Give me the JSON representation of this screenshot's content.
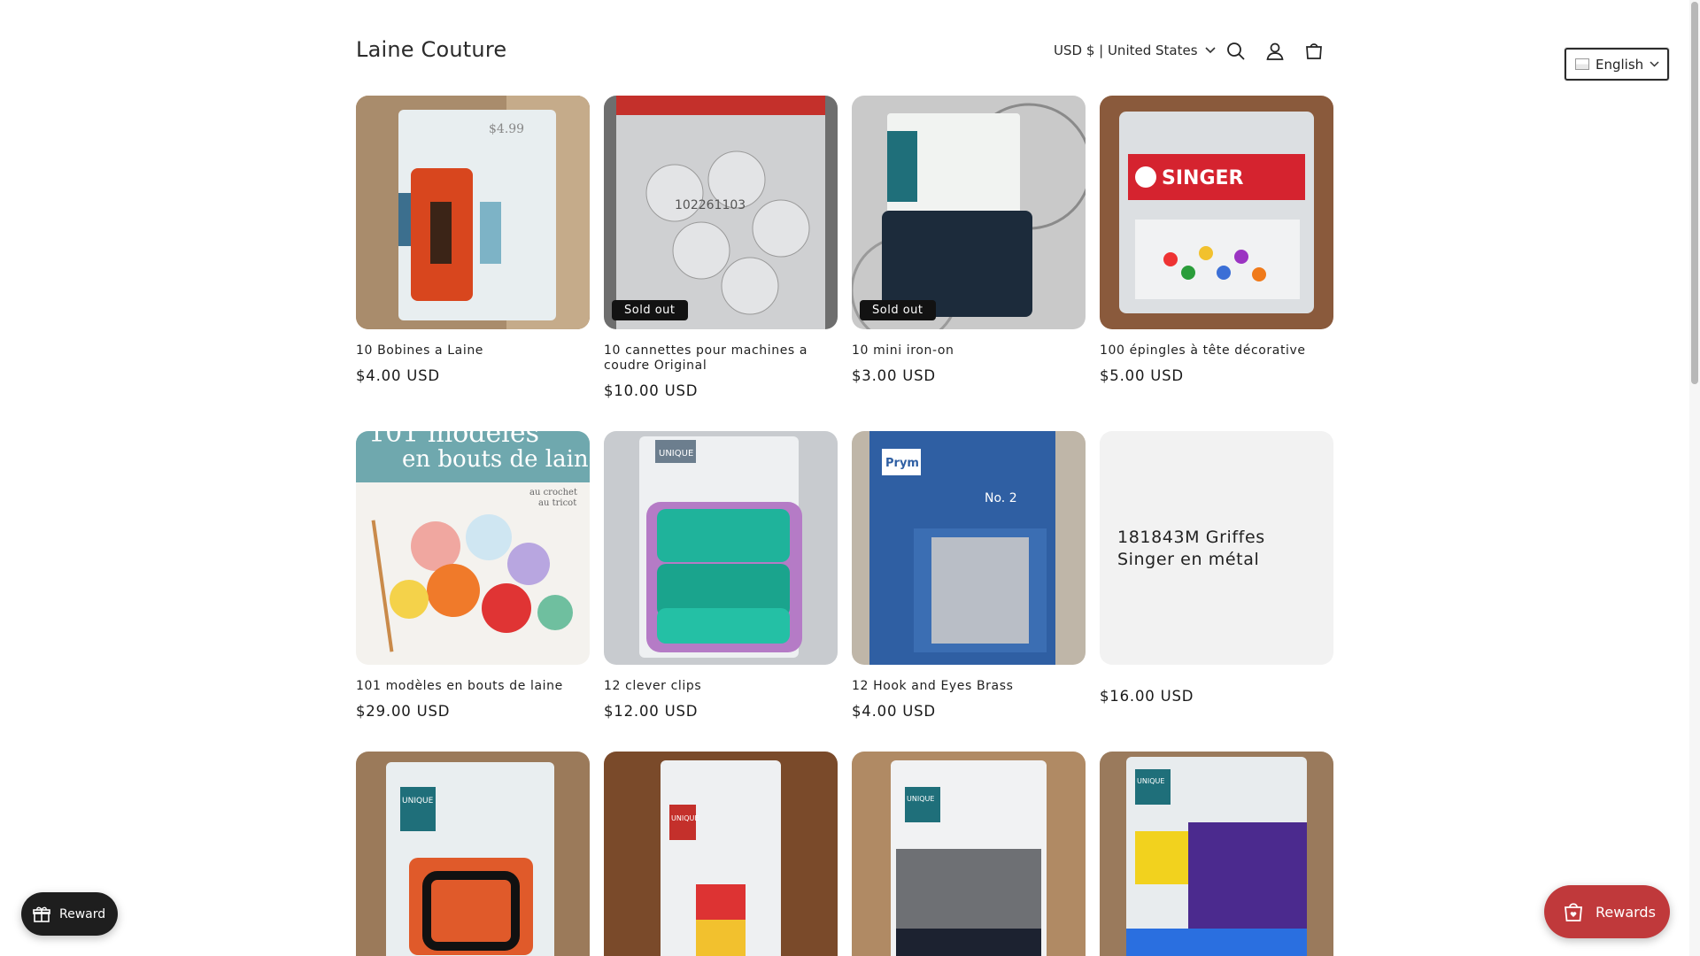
{
  "store": {
    "name": "Laine Couture"
  },
  "header": {
    "locale_label": "USD $ | United States"
  },
  "language": {
    "selected": "English"
  },
  "products": [
    {
      "title": "10 Bobines a Laine",
      "price": "$4.00 USD",
      "badge": ""
    },
    {
      "title": "10 cannettes pour machines a coudre Original",
      "price": "$10.00 USD",
      "badge": "Sold out"
    },
    {
      "title": "10 mini iron-on",
      "price": "$3.00 USD",
      "badge": "Sold out"
    },
    {
      "title": "100 épingles à tête décorative",
      "price": "$5.00 USD",
      "badge": ""
    },
    {
      "title": "101 modèles en bouts de laine",
      "price": "$29.00 USD",
      "badge": ""
    },
    {
      "title": "12 clever clips",
      "price": "$12.00 USD",
      "badge": ""
    },
    {
      "title": "12 Hook and Eyes Brass",
      "price": "$4.00 USD",
      "badge": ""
    },
    {
      "title": "181843M Griffes Singer en métal",
      "price": "$16.00 USD",
      "badge": ""
    },
    {
      "title": "",
      "price": "",
      "badge": ""
    },
    {
      "title": "",
      "price": "",
      "badge": ""
    },
    {
      "title": "",
      "price": "",
      "badge": ""
    },
    {
      "title": "",
      "price": "",
      "badge": ""
    }
  ],
  "product_images": [
    {
      "text": "$4.99"
    },
    {
      "text": "102261103"
    },
    {
      "text": ""
    },
    {
      "text": "SINGER"
    },
    {
      "text": "101 modèles",
      "text2": "en bouts de laine",
      "text3": "au crochet",
      "text4": "au tricot"
    },
    {
      "text": "UNIQUE"
    },
    {
      "text": "Prym",
      "text2": "No. 2"
    },
    {
      "text": ""
    },
    {
      "text": "UNIQUE"
    },
    {
      "text": "UNIQUE"
    },
    {
      "text": "UNIQUE"
    },
    {
      "text": "UNIQUE"
    }
  ],
  "widgets": {
    "reward_label": "Reward",
    "rewards_label": "Rewards"
  }
}
